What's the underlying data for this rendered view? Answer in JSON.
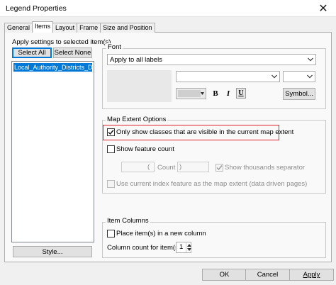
{
  "window": {
    "title": "Legend Properties",
    "close_glyph": "✕"
  },
  "tabs": [
    {
      "label": "General",
      "active": false
    },
    {
      "label": "Items",
      "active": true
    },
    {
      "label": "Layout",
      "active": false
    },
    {
      "label": "Frame",
      "active": false
    },
    {
      "label": "Size and Position",
      "active": false
    }
  ],
  "items_panel": {
    "apply_label": "Apply settings to selected item(s)",
    "select_all": "Select All",
    "select_none": "Select None",
    "list_items": [
      "Local_Authority_Districts_Dec"
    ],
    "style_button": "Style..."
  },
  "font_group": {
    "title": "Font",
    "apply_combo_value": "Apply to all labels",
    "font_name_value": "",
    "font_size_value": "",
    "bold_label": "B",
    "italic_label": "I",
    "underline_label": "U",
    "symbol_button": "Symbol..."
  },
  "map_extent": {
    "title": "Map Extent Options",
    "only_show_label": "Only show classes that are visible in the current map extent",
    "only_show_checked": true,
    "show_count_label": "Show feature count",
    "show_count_checked": false,
    "open_paren": "(",
    "count_label": "Count",
    "close_paren": ")",
    "thousands_label": "Show thousands separator",
    "thousands_checked": true,
    "index_label": "Use current index feature as the map extent (data driven pages)",
    "index_checked": false
  },
  "item_columns": {
    "title": "Item Columns",
    "new_column_label": "Place item(s) in a new column",
    "new_column_checked": false,
    "column_count_label": "Column count for item(s)",
    "column_count_value": "1"
  },
  "footer": {
    "ok": "OK",
    "cancel": "Cancel",
    "apply": "Apply"
  },
  "colors": {
    "accent": "#0078d7",
    "highlight": "#e0202a"
  }
}
